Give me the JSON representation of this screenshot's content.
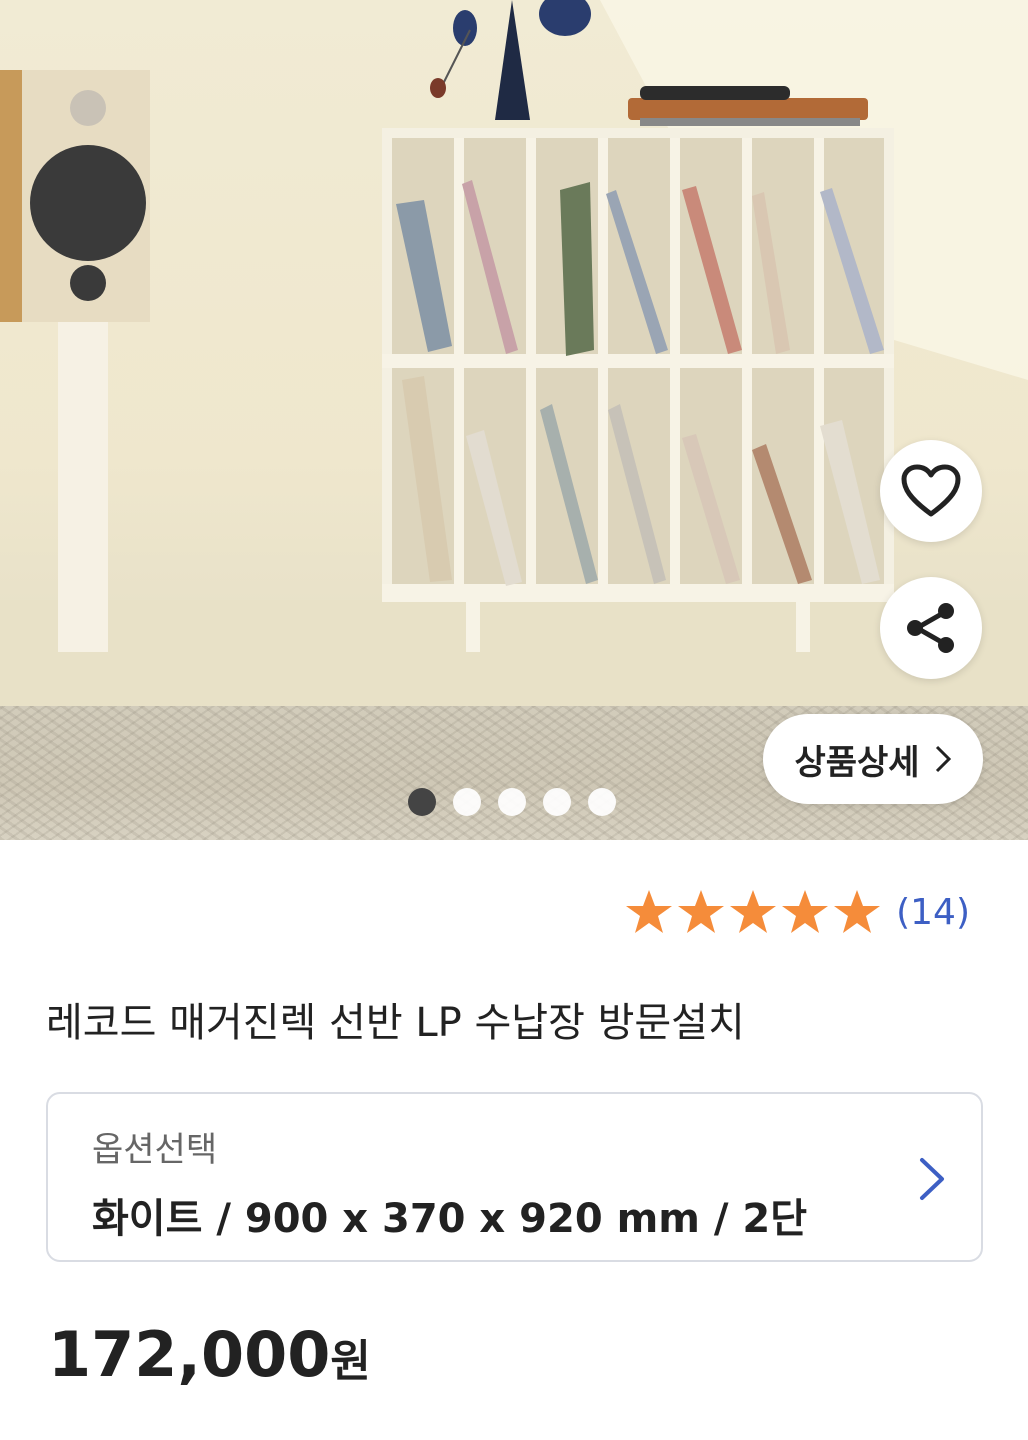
{
  "gallery": {
    "image_alt": "record shelf product photo",
    "slide_count": 5,
    "active_slide": 1,
    "detail_button_label": "상품상세"
  },
  "actions": {
    "like_icon": "heart-outline-icon",
    "share_icon": "share-icon"
  },
  "rating": {
    "stars": 5,
    "count_label": "(14)",
    "star_color": "#f58c3a"
  },
  "product": {
    "title": "레코드 매거진렉 선반 LP 수납장 방문설치",
    "option_label": "옵션선택",
    "option_value": "화이트 / 900 x 370 x 920 mm / 2단",
    "price": "172,000",
    "price_unit": "원"
  },
  "colors": {
    "accent_blue": "#3d5fc4",
    "text_dark": "#222222"
  }
}
